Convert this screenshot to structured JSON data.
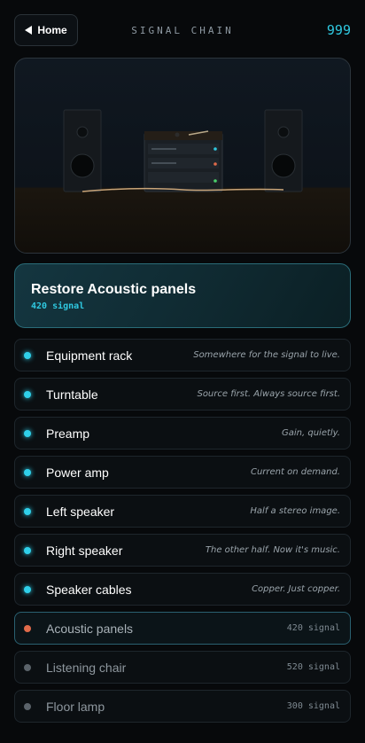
{
  "header": {
    "home_label": "Home",
    "title": "SIGNAL CHAIN",
    "counter": "999"
  },
  "active": {
    "title": "Restore Acoustic panels",
    "subtitle": "420 signal"
  },
  "items": [
    {
      "label": "Equipment rack",
      "note": "Somewhere for the signal to live.",
      "status": "on"
    },
    {
      "label": "Turntable",
      "note": "Source first. Always source first.",
      "status": "on"
    },
    {
      "label": "Preamp",
      "note": "Gain, quietly.",
      "status": "on"
    },
    {
      "label": "Power amp",
      "note": "Current on demand.",
      "status": "on"
    },
    {
      "label": "Left speaker",
      "note": "Half a stereo image.",
      "status": "on"
    },
    {
      "label": "Right speaker",
      "note": "The other half. Now it's music.",
      "status": "on"
    },
    {
      "label": "Speaker cables",
      "note": "Copper. Just copper.",
      "status": "on"
    },
    {
      "label": "Acoustic panels",
      "note": "420 signal",
      "status": "warn"
    },
    {
      "label": "Listening chair",
      "note": "520 signal",
      "status": "off"
    },
    {
      "label": "Floor lamp",
      "note": "300 signal",
      "status": "off"
    }
  ],
  "colors": {
    "accent": "#2fc8e0",
    "warn": "#e06a4a",
    "inactive": "#5b636a"
  },
  "icons": {
    "home": "back-arrow-icon"
  }
}
